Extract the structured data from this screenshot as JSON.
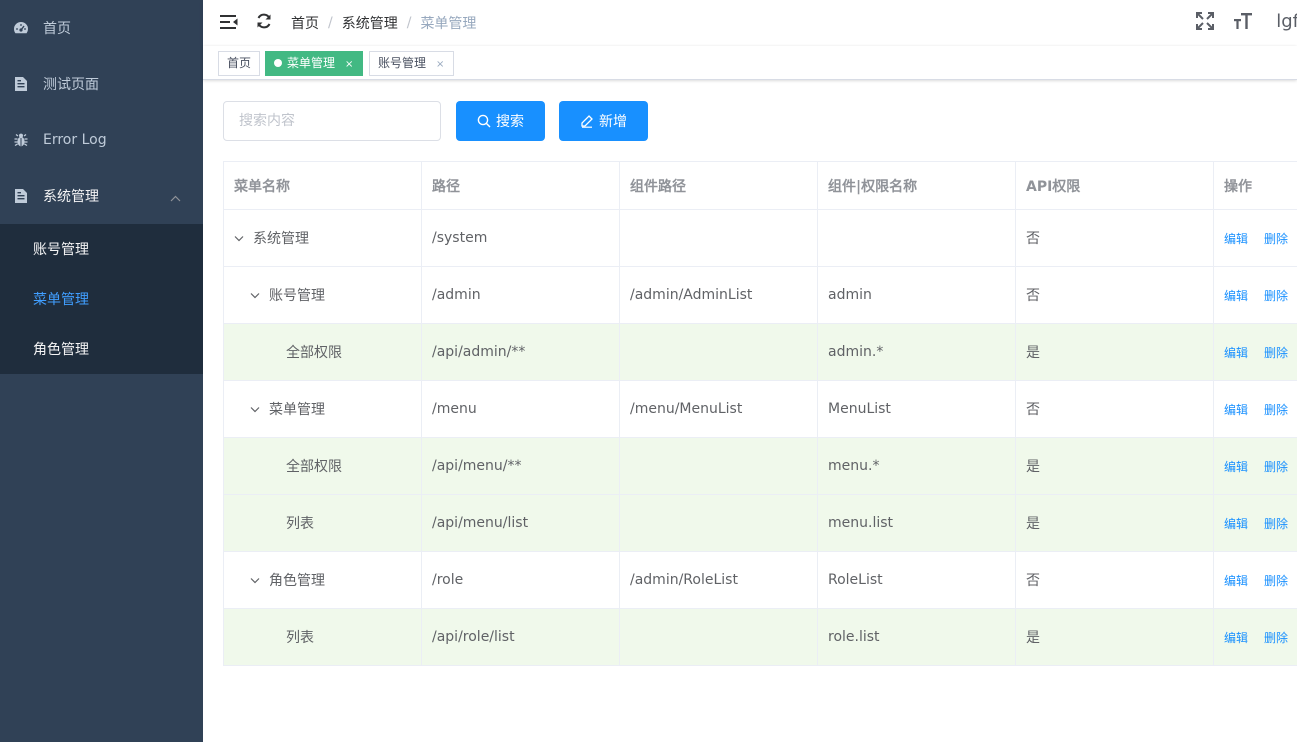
{
  "sidebar": {
    "items": [
      {
        "label": "首页",
        "icon": "dashboard-icon"
      },
      {
        "label": "测试页面",
        "icon": "document-icon"
      },
      {
        "label": "Error Log",
        "icon": "bug-icon"
      },
      {
        "label": "系统管理",
        "icon": "document-icon"
      }
    ],
    "submenu": [
      {
        "label": "账号管理",
        "active": false
      },
      {
        "label": "菜单管理",
        "active": true
      },
      {
        "label": "角色管理",
        "active": false
      }
    ]
  },
  "navbar": {
    "breadcrumb": [
      "首页",
      "系统管理",
      "菜单管理"
    ],
    "separator": "/",
    "username": "lgf"
  },
  "tags": [
    {
      "label": "首页",
      "active": false
    },
    {
      "label": "菜单管理",
      "active": true,
      "close": "×"
    },
    {
      "label": "账号管理",
      "active": false,
      "close": "×"
    }
  ],
  "toolbar": {
    "search_placeholder": "搜索内容",
    "search_label": "搜索",
    "add_label": "新增"
  },
  "table": {
    "headers": [
      "菜单名称",
      "路径",
      "组件路径",
      "组件|权限名称",
      "API权限",
      "操作"
    ],
    "rows": [
      {
        "name": "系统管理",
        "path": "/system",
        "component": "",
        "perm": "",
        "api": "否"
      },
      {
        "name": "账号管理",
        "path": "/admin",
        "component": "/admin/AdminList",
        "perm": "admin",
        "api": "否"
      },
      {
        "name": "全部权限",
        "path": "/api/admin/**",
        "component": "",
        "perm": "admin.*",
        "api": "是"
      },
      {
        "name": "菜单管理",
        "path": "/menu",
        "component": "/menu/MenuList",
        "perm": "MenuList",
        "api": "否"
      },
      {
        "name": "全部权限",
        "path": "/api/menu/**",
        "component": "",
        "perm": "menu.*",
        "api": "是"
      },
      {
        "name": "列表",
        "path": "/api/menu/list",
        "component": "",
        "perm": "menu.list",
        "api": "是"
      },
      {
        "name": "角色管理",
        "path": "/role",
        "component": "/admin/RoleList",
        "perm": "RoleList",
        "api": "否"
      },
      {
        "name": "列表",
        "path": "/api/role/list",
        "component": "",
        "perm": "role.list",
        "api": "是"
      }
    ],
    "edit_label": "编辑",
    "delete_label": "删除"
  },
  "colors": {
    "sidebar_bg": "#304156",
    "submenu_bg": "#1f2d3d",
    "accent": "#1890ff",
    "active_tag": "#42b983",
    "leaf_row_bg": "#f0f9eb"
  }
}
